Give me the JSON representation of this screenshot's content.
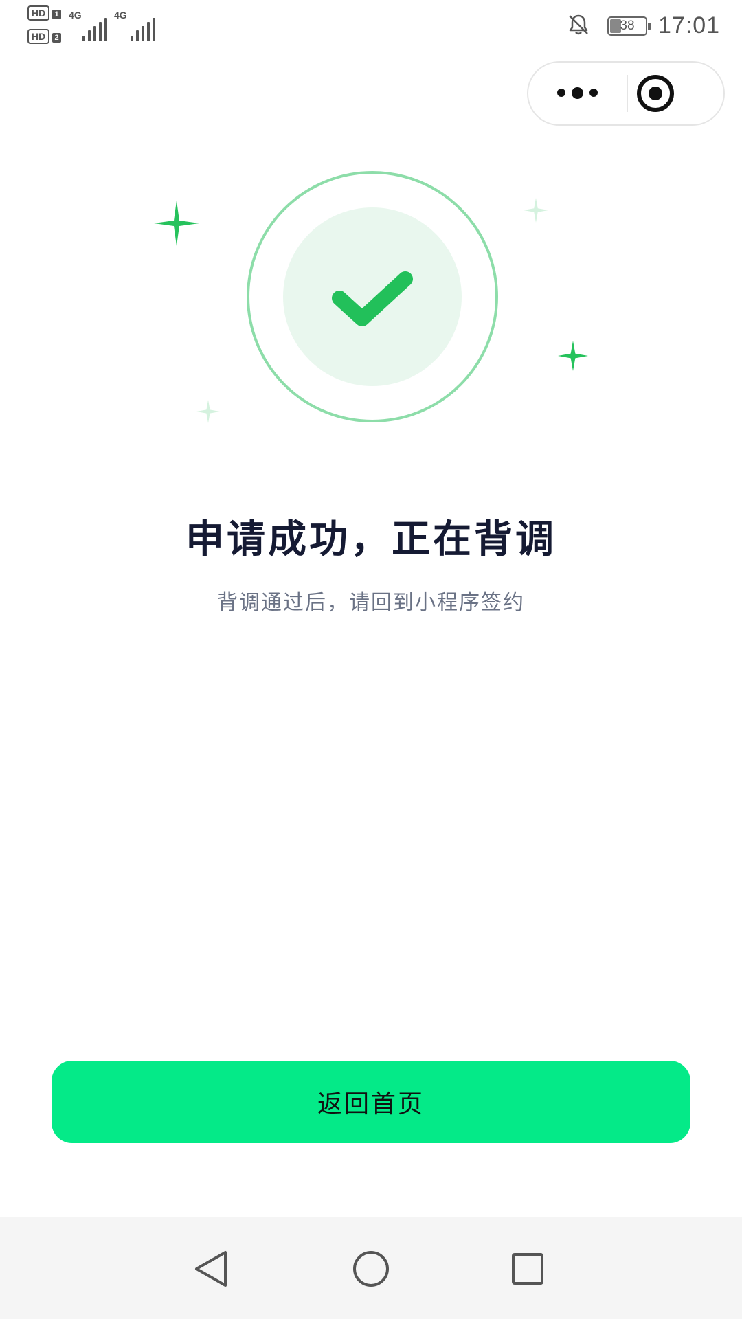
{
  "status_bar": {
    "sim1_label": "HD",
    "sim1_index": "1",
    "sim2_label": "HD",
    "sim2_index": "2",
    "network1": "4G",
    "network2": "4G",
    "battery_level": "38",
    "time": "17:01",
    "icons": [
      "signal-icon",
      "bell-off-icon",
      "battery-icon"
    ]
  },
  "capsule": {
    "more_icon": "more-icon",
    "close_icon": "target-close-icon"
  },
  "result": {
    "icon": "check-icon",
    "title": "申请成功，正在背调",
    "subtitle": "背调通过后，请回到小程序签约"
  },
  "actions": {
    "home_label": "返回首页"
  },
  "navigation": {
    "back_icon": "back-triangle-icon",
    "home_icon": "home-circle-icon",
    "recents_icon": "recents-square-icon"
  },
  "colors": {
    "accent": "#04ea88",
    "check_green": "#22c05a",
    "ring_green": "#8ddda9",
    "inner_circle": "#e9f7ee"
  }
}
